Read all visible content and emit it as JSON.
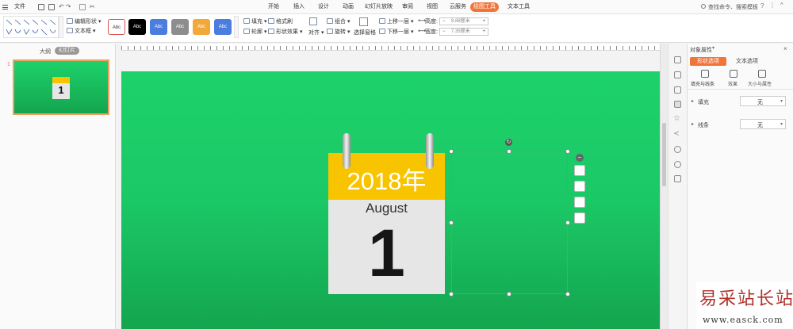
{
  "menu": {
    "file": "文件",
    "undo_arrows": "↶ ↷"
  },
  "tabs": [
    {
      "label": "开始",
      "active": false
    },
    {
      "label": "插入",
      "active": false
    },
    {
      "label": "设计",
      "active": false
    },
    {
      "label": "动画",
      "active": false
    },
    {
      "label": "幻灯片放映",
      "active": false
    },
    {
      "label": "审阅",
      "active": false
    },
    {
      "label": "视图",
      "active": false
    },
    {
      "label": "云服务",
      "active": false
    },
    {
      "label": "绘图工具",
      "active": true
    },
    {
      "label": "文本工具",
      "active": false
    }
  ],
  "search": {
    "text": "查找命令、搜索模板"
  },
  "ribbon": {
    "edit_shape": "编辑形状",
    "textbox": "文本框",
    "style_label": "Abc",
    "styles": [
      {
        "bg": "#ffffff",
        "fg": "#333333",
        "border": "#d9534f"
      },
      {
        "bg": "#000000",
        "fg": "#ffffff",
        "border": "#000000"
      },
      {
        "bg": "#4a7dde",
        "fg": "#ffffff",
        "border": "#4a7dde"
      },
      {
        "bg": "#8d8d8d",
        "fg": "#ffffff",
        "border": "#8d8d8d"
      },
      {
        "bg": "#f3a83a",
        "fg": "#ffffff",
        "border": "#f3a83a"
      },
      {
        "bg": "#4a7dde",
        "fg": "#ffffff",
        "border": "#4a7dde"
      }
    ],
    "fill": "填充",
    "format_brush": "格式刷",
    "outline": "轮廓",
    "shape_effect": "形状效果",
    "align": "对齐",
    "group": "组合",
    "rotate": "旋转",
    "select_pane": "选择窗格",
    "bring_forward": "上移一层",
    "send_backward": "下移一层",
    "height_label": "高度:",
    "height_value": "8.88厘米",
    "width_label": "宽度:",
    "width_value": "7.35厘米"
  },
  "left_panel": {
    "tab_outline": "大纲",
    "tab_slides": "幻灯片",
    "slide_number": "1"
  },
  "calendar": {
    "year": "2018年",
    "month": "August",
    "day": "1",
    "year_bg": "#f8c400",
    "body_bg": "#e6e6e6"
  },
  "right_panel": {
    "title": "对象属性",
    "tab_shape": "形状选项",
    "tab_text": "文本选项",
    "sub_fill_line": "填充与线条",
    "sub_effect": "效果",
    "sub_size": "大小与属性",
    "fill_label": "填充",
    "fill_value": "无",
    "line_label": "线条",
    "line_value": "无"
  },
  "watermark": {
    "title": "易采站长站",
    "url": "www.easck.com"
  }
}
